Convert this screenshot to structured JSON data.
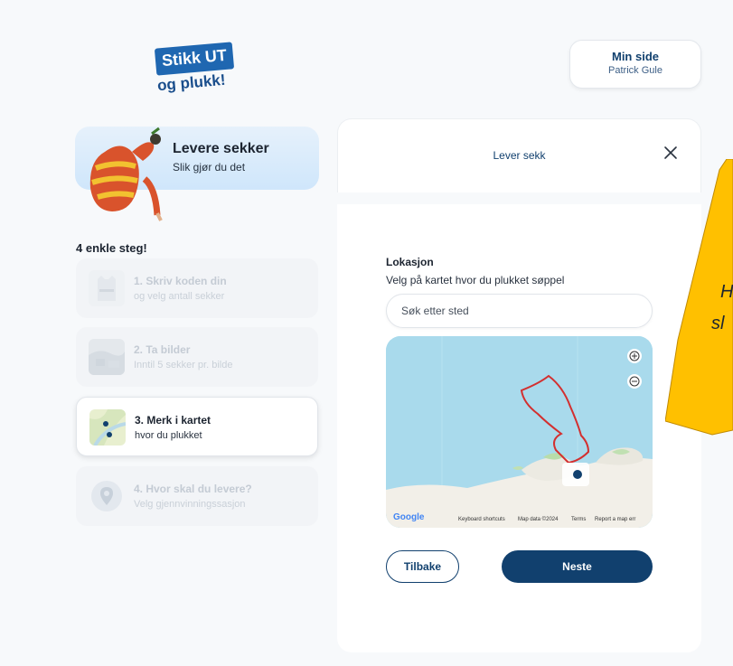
{
  "logo": {
    "line1": "Stikk UT",
    "line2": "og plukk!"
  },
  "user": {
    "heading": "Min side",
    "name": "Patrick Gule"
  },
  "hero": {
    "title": "Levere sekker",
    "subtitle": "Slik gjør du det"
  },
  "steps_title": "4 enkle steg!",
  "steps": [
    {
      "title": "1. Skriv koden din",
      "subtitle": "og velg antall sekker",
      "active": false
    },
    {
      "title": "2. Ta bilder",
      "subtitle": "Inntil 5 sekker pr. bilde",
      "active": false
    },
    {
      "title": "3. Merk i kartet",
      "subtitle": "hvor du plukket",
      "active": true
    },
    {
      "title": "4. Hvor skal du levere?",
      "subtitle": "Velg gjennvinningssasjon",
      "active": false
    }
  ],
  "panel": {
    "title": "Lever sekk",
    "location_label": "Lokasjon",
    "location_hint": "Velg på kartet hvor du plukket søppel",
    "search_placeholder": "Søk etter sted",
    "map_footer": {
      "google": "Google",
      "shortcuts": "Keyboard shortcuts",
      "map_data": "Map data ©2024",
      "terms": "Terms",
      "report": "Report a map err"
    },
    "back_label": "Tilbake",
    "next_label": "Neste"
  },
  "callout": {
    "text_line1": "H",
    "text_line2": "sl"
  },
  "colors": {
    "primary": "#11406e",
    "callout": "#ffc000",
    "map_water": "#a9daec",
    "route": "#d32f2f"
  }
}
